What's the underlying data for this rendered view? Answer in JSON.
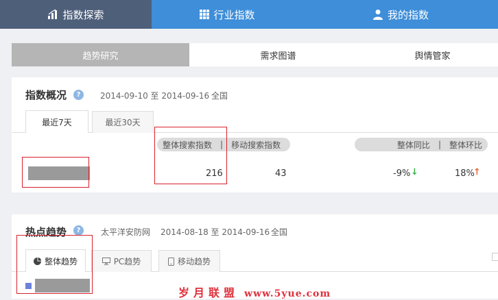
{
  "topnav": {
    "explore": "指数探索",
    "industry": "行业指数",
    "mine": "我的指数"
  },
  "subtabs": {
    "trend": "趋势研究",
    "demand": "需求图谱",
    "opinion": "舆情管家"
  },
  "overview": {
    "title": "指数概况",
    "help": "?",
    "date_range": "2014-09-10 至 2014-09-16",
    "region": "全国",
    "tabs": [
      "最近7天",
      "最近30天"
    ],
    "col_overall": "整体搜索指数",
    "col_mobile": "移动搜索指数",
    "col_yoy": "整体同比",
    "col_mom": "整体环比",
    "sep": "|",
    "overall_value": "216",
    "mobile_value": "43",
    "yoy_value": "-9%",
    "mom_value": "18%",
    "yoy_color": "#3bb54a",
    "mom_color": "#e8693e"
  },
  "hot": {
    "title": "热点趋势",
    "help": "?",
    "keyword": "太平洋安防网",
    "date_range": "2014-08-18 至 2014-09-16",
    "region": "全国",
    "tabs": [
      "整体趋势",
      "PC趋势",
      "移动趋势"
    ]
  },
  "watermark": {
    "cn": "岁月联盟",
    "url": "www.5yue.com"
  }
}
